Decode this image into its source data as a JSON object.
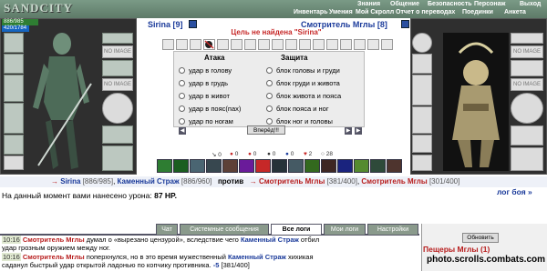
{
  "header": {
    "logo": "SANDCITY",
    "menu_row1": [
      "Знания",
      "Общение",
      "Безопасность",
      "Персонаж",
      "Выход"
    ],
    "menu_row2": [
      "Инвентарь",
      "Умения",
      "Мой Скролл",
      "Отчет о переводах",
      "Поединки",
      "Анкета"
    ]
  },
  "player_left": {
    "name": "Sirina [9]",
    "hp": "886/985",
    "mp": "420/1784",
    "hp_fraction": 0.9,
    "mp_fraction": 0.24,
    "no_image": "NO IMAGE"
  },
  "player_right": {
    "name": "Смотритель Мглы [8]",
    "no_image": "NO IMAGE"
  },
  "combat": {
    "target_msg": "Цель не найдена \"Sirina\"",
    "attack_header": "Атака",
    "defense_header": "Защита",
    "attack_options": [
      "удар в голову",
      "удар в грудь",
      "удар в живот",
      "удар в пояс(пах)",
      "удар по ногам"
    ],
    "defense_options": [
      "блок головы и груди",
      "блок груди и живота",
      "блок живота и пояса",
      "блок пояса и ног",
      "блок ног и головы"
    ],
    "attack_button": "Вперёд!!!"
  },
  "counters": [
    "0",
    "0",
    "0",
    "0",
    "0",
    "2",
    "28"
  ],
  "effect_colors": [
    "#2e7d32",
    "#1b5e20",
    "#4a6572",
    "#37474f",
    "#5d4037",
    "#6a1b9a",
    "#c62828",
    "#263238",
    "#455a64",
    "#33691e",
    "#3e2723",
    "#1a237e",
    "#558b2f",
    "#2e4a3a",
    "#4e342e"
  ],
  "vs_line": {
    "player1": "Sirina",
    "player1_hp": "[886/985]",
    "player2": "Каменный Страж",
    "player2_hp": "[886/960]",
    "vs": "против",
    "enemy1": "Смотритель Мглы",
    "enemy1_hp": "[381/400]",
    "enemy2": "Смотритель Мглы",
    "enemy2_hp": "[301/400]"
  },
  "damage_line": {
    "text": "На данный момент вами нанесено урона:",
    "value": "87 HP."
  },
  "log_link": "лог боя »",
  "tabs": [
    "Чат",
    "Системные сообщения",
    "Все логи",
    "Мои логи",
    "Настройки"
  ],
  "chat": [
    {
      "time": "10:16",
      "name": "Смотритель Мглы",
      "text1": "думал о «вырезано цензурой», вследствие чего",
      "name2": "Каменный Страж",
      "text2": "отбил"
    },
    {
      "time": "",
      "text": "удар грозным оружием между ног."
    },
    {
      "time": "10:16",
      "name": "Смотритель Мглы",
      "text1": "поперхнулся, но в это время мужественный",
      "name2": "Каменный Страж",
      "text2": "хихикая"
    },
    {
      "time": "",
      "text": "саданул быстрый удар открытой ладонью по копчику противника.",
      "dmg": "-5",
      "hp": "[381/400]"
    }
  ],
  "right_panel": {
    "refresh": "Обновить",
    "location": "Пещеры Мглы (1)",
    "watermark": "photo.scrolls.combats.com"
  },
  "colors": {
    "accent_red": "#b71c1c",
    "accent_blue": "#1a3a9a",
    "topbar": "#6b8a76"
  }
}
